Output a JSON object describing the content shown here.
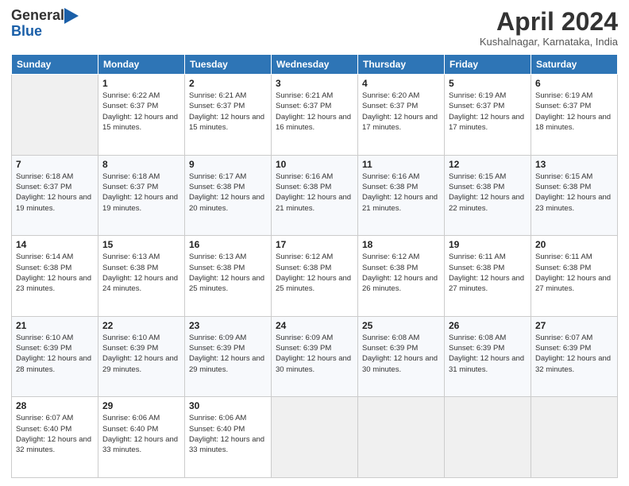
{
  "header": {
    "logo_general": "General",
    "logo_blue": "Blue",
    "month_title": "April 2024",
    "location": "Kushalnagar, Karnataka, India"
  },
  "calendar": {
    "days_of_week": [
      "Sunday",
      "Monday",
      "Tuesday",
      "Wednesday",
      "Thursday",
      "Friday",
      "Saturday"
    ],
    "weeks": [
      [
        {
          "day": "",
          "sunrise": "",
          "sunset": "",
          "daylight": ""
        },
        {
          "day": "1",
          "sunrise": "Sunrise: 6:22 AM",
          "sunset": "Sunset: 6:37 PM",
          "daylight": "Daylight: 12 hours and 15 minutes."
        },
        {
          "day": "2",
          "sunrise": "Sunrise: 6:21 AM",
          "sunset": "Sunset: 6:37 PM",
          "daylight": "Daylight: 12 hours and 15 minutes."
        },
        {
          "day": "3",
          "sunrise": "Sunrise: 6:21 AM",
          "sunset": "Sunset: 6:37 PM",
          "daylight": "Daylight: 12 hours and 16 minutes."
        },
        {
          "day": "4",
          "sunrise": "Sunrise: 6:20 AM",
          "sunset": "Sunset: 6:37 PM",
          "daylight": "Daylight: 12 hours and 17 minutes."
        },
        {
          "day": "5",
          "sunrise": "Sunrise: 6:19 AM",
          "sunset": "Sunset: 6:37 PM",
          "daylight": "Daylight: 12 hours and 17 minutes."
        },
        {
          "day": "6",
          "sunrise": "Sunrise: 6:19 AM",
          "sunset": "Sunset: 6:37 PM",
          "daylight": "Daylight: 12 hours and 18 minutes."
        }
      ],
      [
        {
          "day": "7",
          "sunrise": "Sunrise: 6:18 AM",
          "sunset": "Sunset: 6:37 PM",
          "daylight": "Daylight: 12 hours and 19 minutes."
        },
        {
          "day": "8",
          "sunrise": "Sunrise: 6:18 AM",
          "sunset": "Sunset: 6:37 PM",
          "daylight": "Daylight: 12 hours and 19 minutes."
        },
        {
          "day": "9",
          "sunrise": "Sunrise: 6:17 AM",
          "sunset": "Sunset: 6:38 PM",
          "daylight": "Daylight: 12 hours and 20 minutes."
        },
        {
          "day": "10",
          "sunrise": "Sunrise: 6:16 AM",
          "sunset": "Sunset: 6:38 PM",
          "daylight": "Daylight: 12 hours and 21 minutes."
        },
        {
          "day": "11",
          "sunrise": "Sunrise: 6:16 AM",
          "sunset": "Sunset: 6:38 PM",
          "daylight": "Daylight: 12 hours and 21 minutes."
        },
        {
          "day": "12",
          "sunrise": "Sunrise: 6:15 AM",
          "sunset": "Sunset: 6:38 PM",
          "daylight": "Daylight: 12 hours and 22 minutes."
        },
        {
          "day": "13",
          "sunrise": "Sunrise: 6:15 AM",
          "sunset": "Sunset: 6:38 PM",
          "daylight": "Daylight: 12 hours and 23 minutes."
        }
      ],
      [
        {
          "day": "14",
          "sunrise": "Sunrise: 6:14 AM",
          "sunset": "Sunset: 6:38 PM",
          "daylight": "Daylight: 12 hours and 23 minutes."
        },
        {
          "day": "15",
          "sunrise": "Sunrise: 6:13 AM",
          "sunset": "Sunset: 6:38 PM",
          "daylight": "Daylight: 12 hours and 24 minutes."
        },
        {
          "day": "16",
          "sunrise": "Sunrise: 6:13 AM",
          "sunset": "Sunset: 6:38 PM",
          "daylight": "Daylight: 12 hours and 25 minutes."
        },
        {
          "day": "17",
          "sunrise": "Sunrise: 6:12 AM",
          "sunset": "Sunset: 6:38 PM",
          "daylight": "Daylight: 12 hours and 25 minutes."
        },
        {
          "day": "18",
          "sunrise": "Sunrise: 6:12 AM",
          "sunset": "Sunset: 6:38 PM",
          "daylight": "Daylight: 12 hours and 26 minutes."
        },
        {
          "day": "19",
          "sunrise": "Sunrise: 6:11 AM",
          "sunset": "Sunset: 6:38 PM",
          "daylight": "Daylight: 12 hours and 27 minutes."
        },
        {
          "day": "20",
          "sunrise": "Sunrise: 6:11 AM",
          "sunset": "Sunset: 6:38 PM",
          "daylight": "Daylight: 12 hours and 27 minutes."
        }
      ],
      [
        {
          "day": "21",
          "sunrise": "Sunrise: 6:10 AM",
          "sunset": "Sunset: 6:39 PM",
          "daylight": "Daylight: 12 hours and 28 minutes."
        },
        {
          "day": "22",
          "sunrise": "Sunrise: 6:10 AM",
          "sunset": "Sunset: 6:39 PM",
          "daylight": "Daylight: 12 hours and 29 minutes."
        },
        {
          "day": "23",
          "sunrise": "Sunrise: 6:09 AM",
          "sunset": "Sunset: 6:39 PM",
          "daylight": "Daylight: 12 hours and 29 minutes."
        },
        {
          "day": "24",
          "sunrise": "Sunrise: 6:09 AM",
          "sunset": "Sunset: 6:39 PM",
          "daylight": "Daylight: 12 hours and 30 minutes."
        },
        {
          "day": "25",
          "sunrise": "Sunrise: 6:08 AM",
          "sunset": "Sunset: 6:39 PM",
          "daylight": "Daylight: 12 hours and 30 minutes."
        },
        {
          "day": "26",
          "sunrise": "Sunrise: 6:08 AM",
          "sunset": "Sunset: 6:39 PM",
          "daylight": "Daylight: 12 hours and 31 minutes."
        },
        {
          "day": "27",
          "sunrise": "Sunrise: 6:07 AM",
          "sunset": "Sunset: 6:39 PM",
          "daylight": "Daylight: 12 hours and 32 minutes."
        }
      ],
      [
        {
          "day": "28",
          "sunrise": "Sunrise: 6:07 AM",
          "sunset": "Sunset: 6:40 PM",
          "daylight": "Daylight: 12 hours and 32 minutes."
        },
        {
          "day": "29",
          "sunrise": "Sunrise: 6:06 AM",
          "sunset": "Sunset: 6:40 PM",
          "daylight": "Daylight: 12 hours and 33 minutes."
        },
        {
          "day": "30",
          "sunrise": "Sunrise: 6:06 AM",
          "sunset": "Sunset: 6:40 PM",
          "daylight": "Daylight: 12 hours and 33 minutes."
        },
        {
          "day": "",
          "sunrise": "",
          "sunset": "",
          "daylight": ""
        },
        {
          "day": "",
          "sunrise": "",
          "sunset": "",
          "daylight": ""
        },
        {
          "day": "",
          "sunrise": "",
          "sunset": "",
          "daylight": ""
        },
        {
          "day": "",
          "sunrise": "",
          "sunset": "",
          "daylight": ""
        }
      ]
    ]
  }
}
